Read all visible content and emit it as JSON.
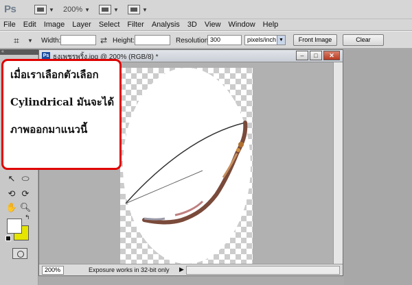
{
  "appbar": {
    "logo": "Ps",
    "zoom": "200%"
  },
  "menu": [
    "File",
    "Edit",
    "Image",
    "Layer",
    "Select",
    "Filter",
    "Analysis",
    "3D",
    "View",
    "Window",
    "Help"
  ],
  "options": {
    "width_label": "Width:",
    "height_label": "Height:",
    "resolution_label": "Resolution:",
    "resolution_value": "300",
    "unit_value": "pixels/inch",
    "front_image_label": "Front Image",
    "clear_label": "Clear"
  },
  "document": {
    "title": "ธงเพชรพริ้ง.jpg @ 200% (RGB/8) *",
    "icon_text": "Ps",
    "zoom": "200%",
    "status_text": "Exposure works in 32-bit only"
  },
  "callout": {
    "line1": "เมื่อเราเลือกตัวเลือก",
    "line2": "Cylindrical มันจะได้",
    "line3": "ภาพออกมาแนวนี้"
  },
  "colors": {
    "callout_border": "#e00000",
    "foreground": "#ffffff",
    "background": "#e5e500"
  }
}
